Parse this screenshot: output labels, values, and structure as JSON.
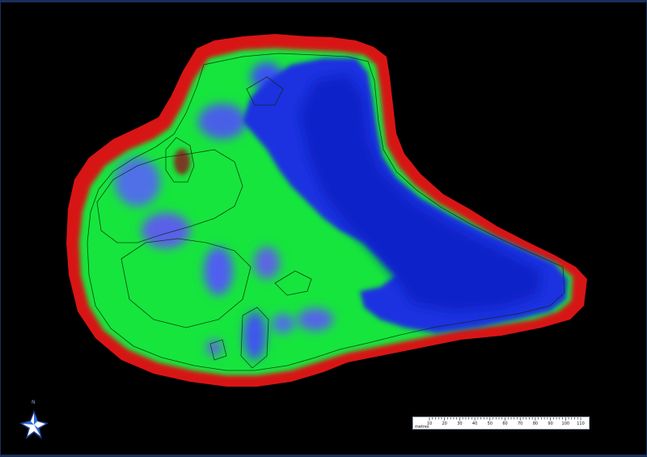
{
  "map": {
    "type": "bathymetric-contour-map",
    "colors": {
      "background": "#000000",
      "frame": "#1a2f5a",
      "shore": "#e01818",
      "shallow": "#12e83a",
      "mid": "#3a6cf0",
      "deep": "#1a2fe0",
      "peak": "#7a3a20",
      "contour": "#0a2a0a"
    }
  },
  "compass": {
    "label": "N",
    "icon": "north-star-icon",
    "color": "#ffffff"
  },
  "scale_bar": {
    "unit_label": "metres",
    "ticks": [
      "10",
      "20",
      "30",
      "40",
      "50",
      "60",
      "70",
      "80",
      "90",
      "100",
      "110"
    ]
  }
}
